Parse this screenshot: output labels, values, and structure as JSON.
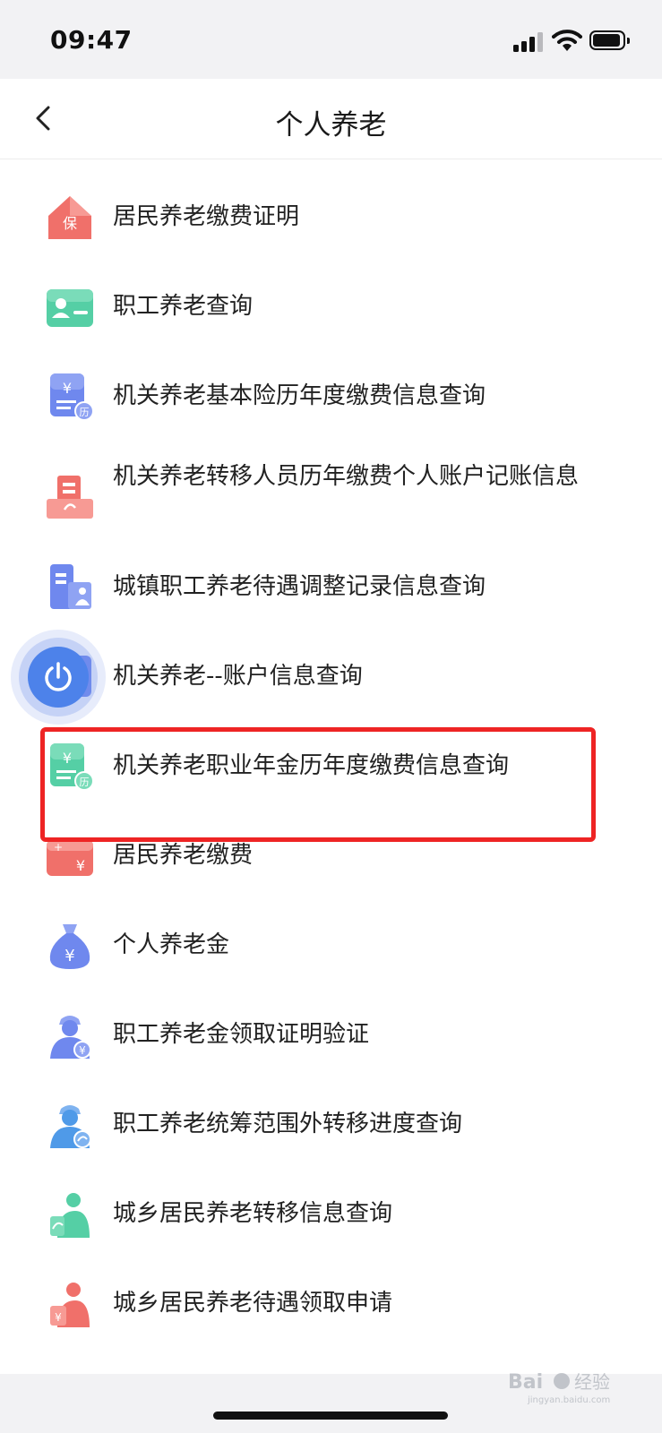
{
  "status_bar": {
    "time": "09:47",
    "icons": [
      "cellular-signal-icon",
      "wifi-icon",
      "battery-icon"
    ]
  },
  "nav": {
    "back_icon": "chevron-left-icon",
    "title": "个人养老"
  },
  "menu": {
    "items": [
      {
        "label": "居民养老缴费证明",
        "icon": "insurance-house-icon",
        "color": "#f0706a"
      },
      {
        "label": "职工养老查询",
        "icon": "id-card-icon",
        "color": "#55cfa5"
      },
      {
        "label": "机关养老基本险历年度缴费信息查询",
        "icon": "yuan-document-history-icon",
        "color": "#6f88ee"
      },
      {
        "label": "机关养老转移人员历年缴费个人账户记账信息",
        "icon": "building-transfer-icon",
        "color": "#f0706a"
      },
      {
        "label": "城镇职工养老待遇调整记录信息查询",
        "icon": "building-person-icon",
        "color": "#6f88ee"
      },
      {
        "label": "机关养老--账户信息查询",
        "icon": "yuan-account-icon",
        "color": "#6f88ee"
      },
      {
        "label": "机关养老职业年金历年度缴费信息查询",
        "icon": "yuan-document-history-icon",
        "color": "#55cfa5"
      },
      {
        "label": "居民养老缴费",
        "icon": "payment-card-icon",
        "color": "#f0706a"
      },
      {
        "label": "个人养老金",
        "icon": "money-bag-icon",
        "color": "#6f88ee"
      },
      {
        "label": "职工养老金领取证明验证",
        "icon": "worker-yuan-icon",
        "color": "#6f88ee"
      },
      {
        "label": "职工养老统筹范围外转移进度查询",
        "icon": "worker-transfer-icon",
        "color": "#4f9ae8"
      },
      {
        "label": "城乡居民养老转移信息查询",
        "icon": "elder-transfer-icon",
        "color": "#55cfa5"
      },
      {
        "label": "城乡居民养老待遇领取申请",
        "icon": "elder-yuan-icon",
        "color": "#f0706a"
      }
    ]
  },
  "floating_button": {
    "icon": "power-icon",
    "color": "#4d82ea"
  },
  "highlight": {
    "color": "#ee2424"
  },
  "watermark": {
    "text": "Bai 经验",
    "sub": "jingyan.baidu.com"
  }
}
